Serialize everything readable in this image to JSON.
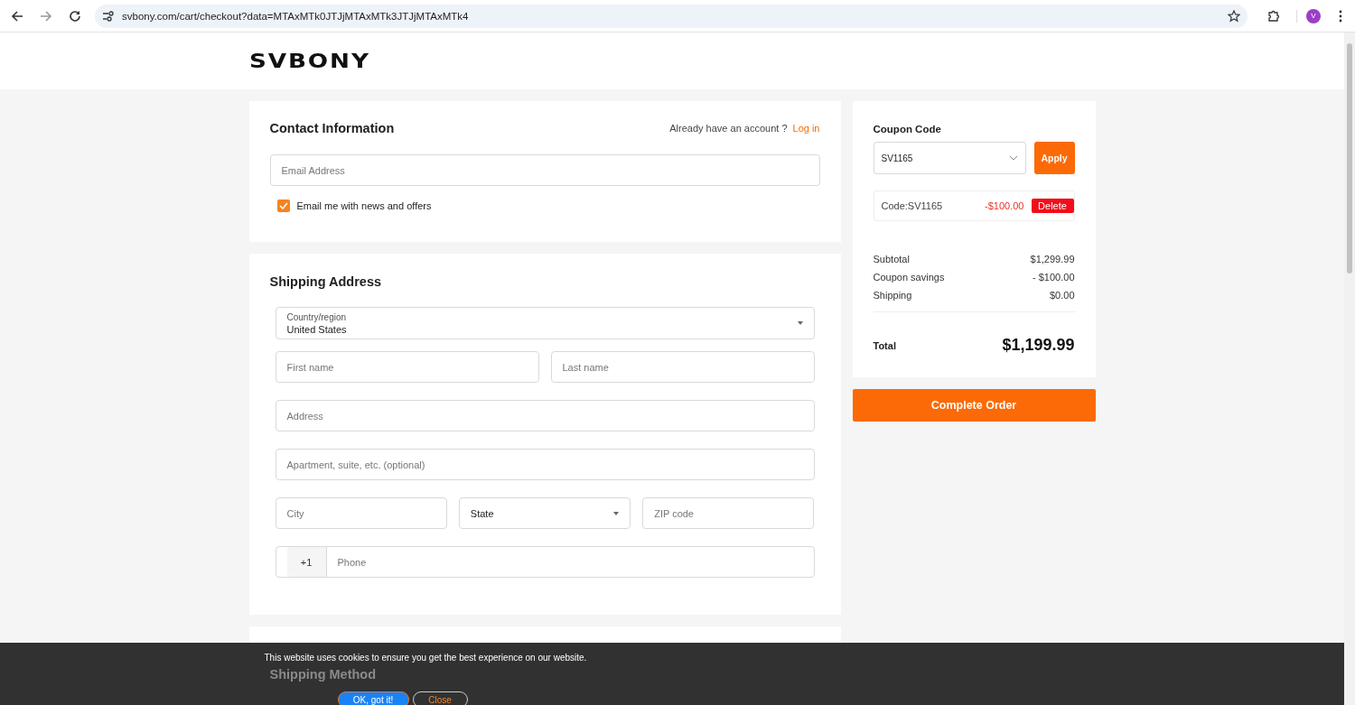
{
  "browser": {
    "url": "svbony.com/cart/checkout?data=MTAxMTk0JTJjMTAxMTk3JTJjMTAxMTk4",
    "profile_initial": "V"
  },
  "site": {
    "logo": "SVBONY"
  },
  "contact": {
    "title": "Contact Information",
    "account_prompt": "Already have an account ?",
    "login_link": "Log in",
    "email_placeholder": "Email Address",
    "newsletter": {
      "label": "Email me with news and offers",
      "checked": true
    }
  },
  "shipping_address": {
    "title": "Shipping Address",
    "country": {
      "label": "Country/region",
      "value": "United States"
    },
    "rows": [
      [
        {
          "kind": "text",
          "placeholder": "First name"
        },
        {
          "kind": "text",
          "placeholder": "Last name"
        }
      ],
      [
        {
          "kind": "text",
          "placeholder": "Address"
        }
      ],
      [
        {
          "kind": "text",
          "placeholder": "Apartment, suite, etc. (optional)"
        }
      ],
      [
        {
          "kind": "text",
          "placeholder": "City"
        },
        {
          "kind": "select",
          "value": "State"
        },
        {
          "kind": "text",
          "placeholder": "ZIP code"
        }
      ],
      [
        {
          "kind": "phone",
          "prefix": "+1",
          "placeholder": "Phone"
        }
      ]
    ]
  },
  "shipping_method": {
    "title": "Shipping Method"
  },
  "coupon": {
    "title": "Coupon Code",
    "selected_code": "SV1165",
    "apply": "Apply",
    "applied": {
      "code": "Code:SV1165",
      "amount": "-$100.00",
      "delete": "Delete"
    }
  },
  "summary": {
    "rows": [
      {
        "label": "Subtotal",
        "value": "$1,299.99"
      },
      {
        "label": "Coupon savings",
        "value": "- $100.00"
      },
      {
        "label": "Shipping",
        "value": "$0.00"
      }
    ],
    "total_label": "Total",
    "total_value": "$1,199.99"
  },
  "complete_order": "Complete Order",
  "cookie_banner": {
    "message": "This website uses cookies to ensure you get the best experience on our website.",
    "accept": "OK, got it!",
    "close": "Close"
  }
}
